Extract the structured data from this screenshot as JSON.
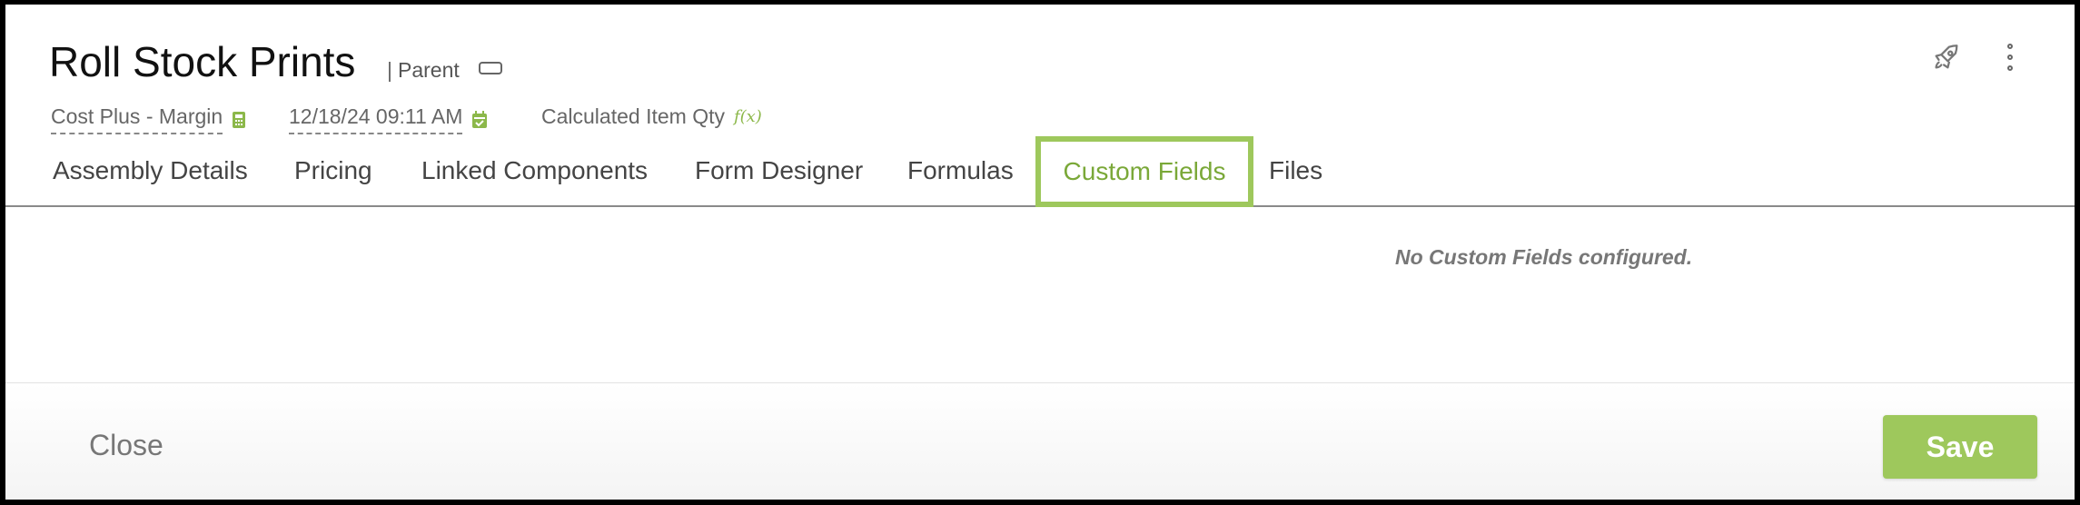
{
  "header": {
    "title": "Roll Stock Prints",
    "parent_bar": "|",
    "parent_label": "Parent"
  },
  "meta": {
    "pricing_method": "Cost Plus - Margin",
    "date": "12/18/24 09:11 AM",
    "qty_label": "Calculated Item Qty",
    "qty_icon_text": "f(x)"
  },
  "tabs": [
    {
      "label": "Assembly Details"
    },
    {
      "label": "Pricing"
    },
    {
      "label": "Linked Components"
    },
    {
      "label": "Form Designer"
    },
    {
      "label": "Formulas"
    },
    {
      "label": "Custom Fields",
      "active": true
    },
    {
      "label": "Files"
    }
  ],
  "content": {
    "empty_message": "No Custom Fields configured."
  },
  "footer": {
    "close_label": "Close",
    "save_label": "Save"
  },
  "colors": {
    "accent": "#9ec85c",
    "accent_text": "#7aa838"
  },
  "icons": {
    "pricing": "calculator-icon",
    "date": "calendar-icon",
    "toggle": "toggle-icon",
    "rocket": "rocket-icon",
    "menu": "more-vertical-icon"
  }
}
